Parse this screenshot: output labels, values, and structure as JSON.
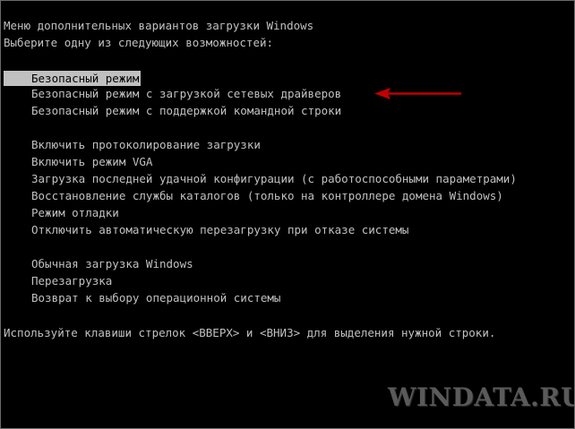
{
  "header": {
    "title": "Меню дополнительных вариантов загрузки Windows",
    "prompt": "Выберите одну из следующих возможностей:"
  },
  "menu": {
    "group1": [
      {
        "label": "Безопасный режим",
        "selected": true
      },
      {
        "label": "Безопасный режим с загрузкой сетевых драйверов",
        "selected": false
      },
      {
        "label": "Безопасный режим с поддержкой командной строки",
        "selected": false
      }
    ],
    "group2": [
      {
        "label": "Включить протоколирование загрузки"
      },
      {
        "label": "Включить режим VGA"
      },
      {
        "label": "Загрузка последней удачной конфигурации (с работоспособными параметрами)"
      },
      {
        "label": "Восстановление службы каталогов (только на контроллере домена Windows)"
      },
      {
        "label": "Режим отладки"
      },
      {
        "label": "Отключить автоматическую перезагрузку при отказе системы"
      }
    ],
    "group3": [
      {
        "label": "Обычная загрузка Windows"
      },
      {
        "label": "Перезагрузка"
      },
      {
        "label": "Возврат к выбору операционной системы"
      }
    ]
  },
  "footer": {
    "hint": "Используйте клавиши стрелок <ВВЕРХ> и <ВНИЗ> для выделения нужной строки."
  },
  "annotation": {
    "arrow_icon": "red-left-arrow",
    "arrow_color": "#c00000"
  },
  "watermark": {
    "text": "WINDATA.RU"
  },
  "colors": {
    "background": "#000000",
    "text": "#c0c0c0",
    "highlight_bg": "#c0c0c0",
    "highlight_text": "#000000"
  }
}
